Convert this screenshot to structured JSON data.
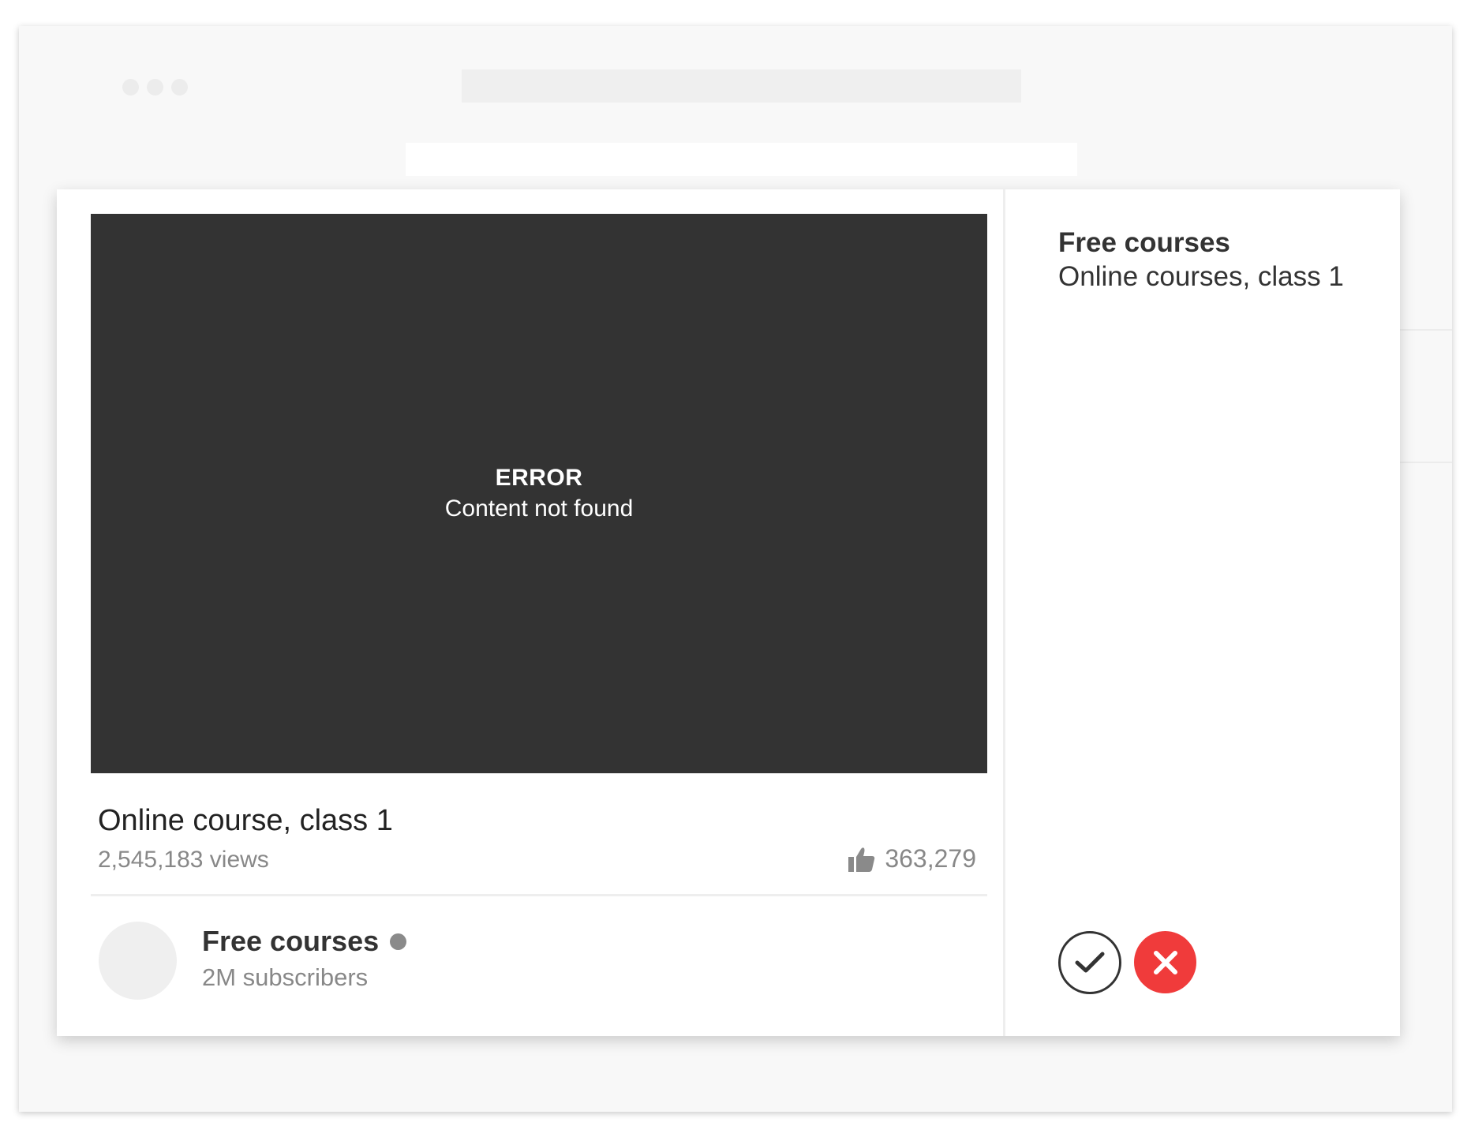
{
  "video": {
    "error_title": "ERROR",
    "error_message": "Content not found",
    "title": "Online course, class 1",
    "views": "2,545,183 views",
    "likes": "363,279"
  },
  "channel": {
    "name": "Free courses",
    "subscribers": "2M subscribers"
  },
  "side_panel": {
    "title": "Free courses",
    "subtitle": "Online courses, class 1"
  },
  "icons": {
    "likes": "thumbs-up-icon",
    "approve": "check-icon",
    "reject": "close-icon",
    "status": "status-dot"
  },
  "colors": {
    "video_background": "#333333",
    "reject_button": "#f03b3b",
    "status_dot": "#8a8a8a"
  }
}
